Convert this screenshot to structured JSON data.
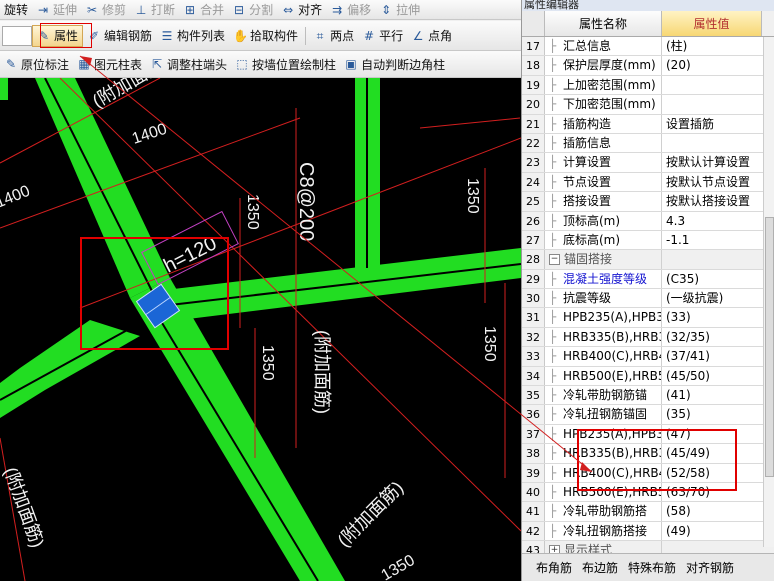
{
  "toolbar1": {
    "items": [
      {
        "label": "旋转",
        "disabled": false
      },
      {
        "label": "延伸",
        "disabled": true
      },
      {
        "label": "修剪",
        "disabled": true
      },
      {
        "label": "打断",
        "disabled": true
      },
      {
        "label": "合并",
        "disabled": true
      },
      {
        "label": "分割",
        "disabled": true
      },
      {
        "label": "对齐",
        "disabled": false
      },
      {
        "label": "偏移",
        "disabled": true
      },
      {
        "label": "拉伸",
        "disabled": true
      }
    ]
  },
  "toolbar2": {
    "items": [
      {
        "label": "属性",
        "icon": "property-icon"
      },
      {
        "label": "编辑钢筋",
        "icon": "edit-rebar-icon"
      },
      {
        "label": "构件列表",
        "icon": "list-icon"
      },
      {
        "label": "拾取构件",
        "icon": "pick-icon"
      },
      {
        "label": "两点",
        "icon": "two-point-icon"
      },
      {
        "label": "平行",
        "icon": "parallel-icon"
      },
      {
        "label": "点角",
        "icon": "point-angle-icon"
      }
    ]
  },
  "toolbar3": {
    "items": [
      {
        "label": "原位标注"
      },
      {
        "label": "图元柱表"
      },
      {
        "label": "调整柱端头"
      },
      {
        "label": "按墙位置绘制柱"
      },
      {
        "label": "自动判断边角柱"
      }
    ]
  },
  "canvas": {
    "labels": [
      "(附加面筋)",
      "1400",
      "1400",
      "h=120",
      "C8@200",
      "1350",
      "1350",
      "(附加面筋)",
      "1350",
      "1350",
      "(附加面筋)",
      "(附加面筋)",
      "1350"
    ]
  },
  "panel": {
    "title": "属性编辑器",
    "col_name": "属性名称",
    "col_value": "属性值",
    "rows": [
      {
        "num": "17",
        "name": "汇总信息",
        "value": "(柱)"
      },
      {
        "num": "18",
        "name": "保护层厚度(mm)",
        "value": "(20)"
      },
      {
        "num": "19",
        "name": "上加密范围(mm)",
        "value": ""
      },
      {
        "num": "20",
        "name": "下加密范围(mm)",
        "value": ""
      },
      {
        "num": "21",
        "name": "插筋构造",
        "value": "设置插筋"
      },
      {
        "num": "22",
        "name": "插筋信息",
        "value": ""
      },
      {
        "num": "23",
        "name": "计算设置",
        "value": "按默认计算设置"
      },
      {
        "num": "24",
        "name": "节点设置",
        "value": "按默认节点设置"
      },
      {
        "num": "25",
        "name": "搭接设置",
        "value": "按默认搭接设置"
      },
      {
        "num": "26",
        "name": "顶标高(m)",
        "value": "4.3"
      },
      {
        "num": "27",
        "name": "底标高(m)",
        "value": "-1.1"
      },
      {
        "num": "28",
        "name": "锚固搭接",
        "value": "",
        "group": true,
        "expander": "−"
      },
      {
        "num": "29",
        "name": "混凝土强度等级",
        "value": "(C35)",
        "blue": true
      },
      {
        "num": "30",
        "name": "抗震等级",
        "value": "(一级抗震)"
      },
      {
        "num": "31",
        "name": "HPB235(A),HPB3",
        "value": "(33)"
      },
      {
        "num": "32",
        "name": "HRB335(B),HRB3",
        "value": "(32/35)"
      },
      {
        "num": "33",
        "name": "HRB400(C),HRB4",
        "value": "(37/41)"
      },
      {
        "num": "34",
        "name": "HRB500(E),HRB5",
        "value": "(45/50)"
      },
      {
        "num": "35",
        "name": "冷轧带肋钢筋锚",
        "value": "(41)"
      },
      {
        "num": "36",
        "name": "冷轧扭钢筋锚固",
        "value": "(35)"
      },
      {
        "num": "37",
        "name": "HPB235(A),HPB3",
        "value": "(47)"
      },
      {
        "num": "38",
        "name": "HRB335(B),HRB3",
        "value": "(45/49)"
      },
      {
        "num": "39",
        "name": "HRB400(C),HRB4",
        "value": "(52/58)"
      },
      {
        "num": "40",
        "name": "HRB500(E),HRB5",
        "value": "(63/70)"
      },
      {
        "num": "41",
        "name": "冷轧带肋钢筋搭",
        "value": "(58)"
      },
      {
        "num": "42",
        "name": "冷轧扭钢筋搭接",
        "value": "(49)"
      },
      {
        "num": "43",
        "name": "显示样式",
        "value": "",
        "group": true,
        "expander": "+"
      }
    ],
    "bottom_tabs": [
      "布角筋",
      "布边筋",
      "特殊布筋",
      "对齐钢筋"
    ]
  }
}
